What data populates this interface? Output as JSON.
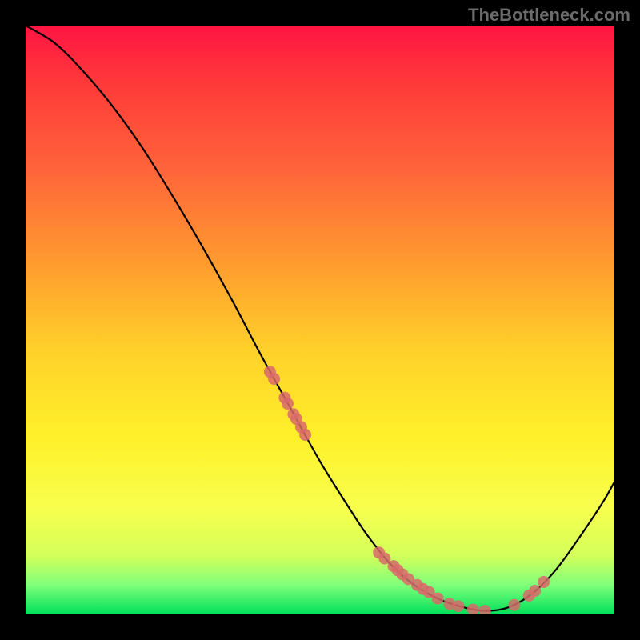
{
  "watermark": "TheBottleneck.com",
  "chart_data": {
    "type": "line",
    "title": "",
    "xlabel": "",
    "ylabel": "",
    "xlim": [
      0,
      100
    ],
    "ylim": [
      0,
      100
    ],
    "series": [
      {
        "name": "curve",
        "x": [
          0,
          5,
          10,
          15,
          20,
          25,
          30,
          35,
          40,
          45,
          50,
          55,
          58,
          62,
          66,
          70,
          74,
          78,
          82,
          86,
          90,
          94,
          98,
          100
        ],
        "y": [
          100,
          97,
          92,
          86,
          79,
          71,
          62.5,
          53.5,
          44,
          35,
          26,
          18,
          13.5,
          8.5,
          5,
          2.7,
          1.3,
          0.6,
          1.2,
          3.5,
          7.5,
          13,
          19,
          22.5
        ]
      }
    ],
    "scatter_points": {
      "x": [
        41.5,
        42.2,
        44,
        44.5,
        45.5,
        46,
        46.8,
        47.5,
        60,
        61,
        62.5,
        63.2,
        64,
        65,
        66.5,
        67.5,
        68.5,
        70,
        72,
        73.5,
        76,
        78,
        83,
        85.5,
        86.5,
        88
      ],
      "y": [
        41.2,
        40,
        36.8,
        35.8,
        34,
        33.2,
        31.8,
        30.5,
        10.5,
        9.5,
        8.2,
        7.5,
        6.8,
        6,
        5,
        4.3,
        3.8,
        2.7,
        1.8,
        1.4,
        0.8,
        0.6,
        1.6,
        3.2,
        4,
        5.5
      ]
    },
    "gradient_stops": [
      {
        "pos": 0,
        "color": "#ff1543"
      },
      {
        "pos": 25,
        "color": "#ff663a"
      },
      {
        "pos": 55,
        "color": "#ffd02a"
      },
      {
        "pos": 82,
        "color": "#f7ff4d"
      },
      {
        "pos": 100,
        "color": "#00e05a"
      }
    ]
  }
}
